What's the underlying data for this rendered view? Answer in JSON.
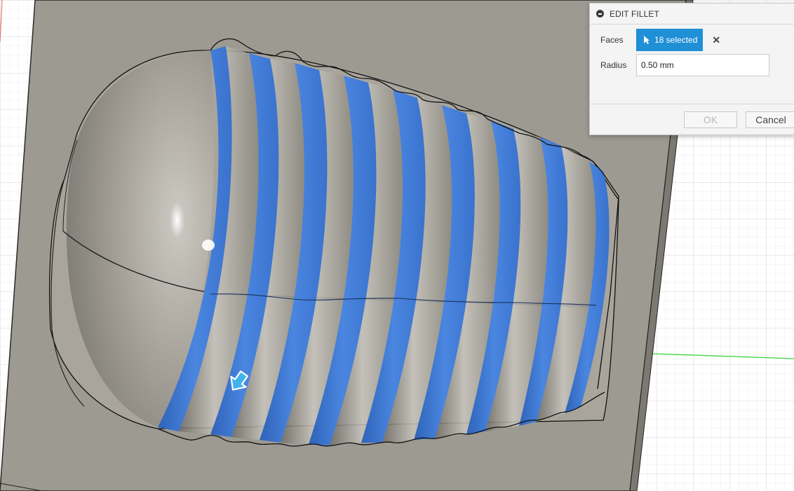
{
  "dialog": {
    "title": "EDIT FILLET",
    "faces_label": "Faces",
    "faces_value": "18 selected",
    "clear_symbol": "✕",
    "radius_label": "Radius",
    "radius_value": "0.50 mm",
    "ok_label": "OK",
    "cancel_label": "Cancel"
  },
  "icons": {
    "collapse": "minus-circle-icon",
    "select_cursor": "cursor-arrow-icon",
    "clear": "close-icon",
    "move_handle": "move-arrow-icon"
  },
  "colors": {
    "selected_face": "#3f78d6",
    "body_gray": "#a9a59d",
    "plate": "#9d9a92",
    "accent": "#1f8fd6",
    "grid_line": "#dcdcdc",
    "axis_green": "#34d334",
    "axis_red": "#e27a7a"
  }
}
